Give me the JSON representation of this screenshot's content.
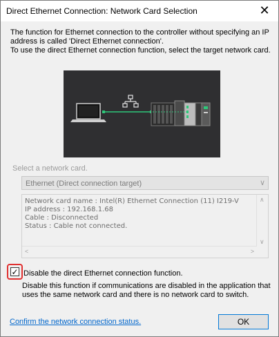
{
  "window": {
    "title": "Direct Ethernet Connection: Network Card Selection"
  },
  "description": {
    "line1": "The function for Ethernet connection to the controller without specifying an IP",
    "line2": "address is called 'Direct Ethernet connection'.",
    "line3": "To use the direct Ethernet connection function, select the target network card."
  },
  "network_card": {
    "label": "Select a network card.",
    "selected": "Ethernet (Direct connection target)"
  },
  "info": {
    "lines": [
      "Network card name    : Intel(R) Ethernet Connection (11) I219-V",
      "IP address : 192.168.1.68",
      "Cable       : Disconnected",
      "Status      : Cable not connected."
    ]
  },
  "disable_option": {
    "label": "Disable the direct Ethernet connection function.",
    "checked": true,
    "note_line1": "Disable this function if communications are disabled in the application that",
    "note_line2": "uses the same network card and there is no network card to switch."
  },
  "footer": {
    "link": "Confirm the network connection status.",
    "ok": "OK"
  },
  "colors": {
    "accent": "#0078d7",
    "link": "#0066cc",
    "highlight": "#e03030",
    "cable": "#2ec87a"
  }
}
